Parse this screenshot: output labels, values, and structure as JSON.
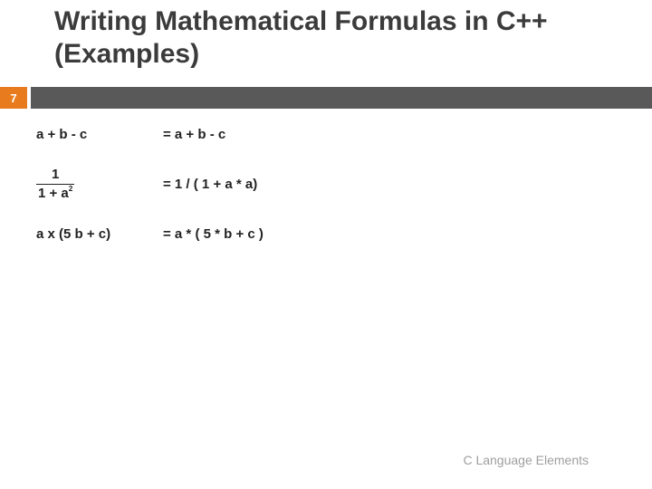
{
  "title": "Writing Mathematical Formulas in C++ (Examples)",
  "page_number": "7",
  "examples": {
    "r1_math": "a + b - c",
    "r1_code": "=  a + b - c",
    "r2_num": "1",
    "r2_den_prefix": "1 + a",
    "r2_den_exp": "2",
    "r2_code": "=  1 / ( 1 + a * a)",
    "r3_math": "a x (5 b + c)",
    "r3_code": "=  a * ( 5 * b + c )"
  },
  "footer": "C Language Elements"
}
